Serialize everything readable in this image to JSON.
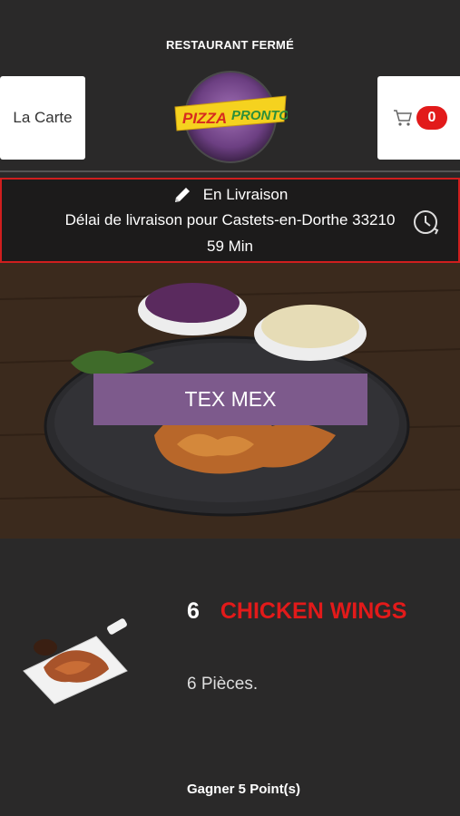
{
  "header": {
    "status": "RESTAURANT FERMÉ",
    "menu_label": "La Carte",
    "cart_count": "0",
    "logo": {
      "part1": "PIZZA",
      "part2": "PRONTO"
    }
  },
  "delivery": {
    "mode": "En Livraison",
    "delay_text": "Délai de livraison pour Castets-en-Dorthe 33210",
    "time": "59 Min"
  },
  "category": {
    "title": "TEX MEX"
  },
  "product": {
    "quantity": "6",
    "name": "CHICKEN WINGS",
    "description": "6 Pièces.",
    "points": "Gagner 5 Point(s)"
  },
  "colors": {
    "background": "#2a2929",
    "accent_red": "#e21a1a",
    "banner_purple": "#7d5a8c",
    "border_red": "#d01e1e"
  },
  "icons": [
    "pencil-icon",
    "clock-refresh-icon",
    "cart-icon"
  ]
}
